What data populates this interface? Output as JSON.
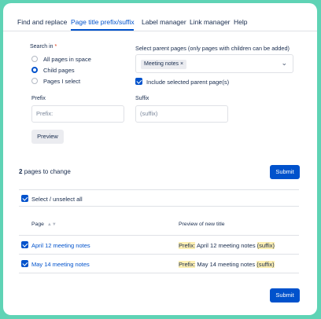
{
  "tabs": [
    "Find and replace",
    "Page title prefix/suffix",
    "Label manager",
    "Link manager",
    "Help"
  ],
  "search_in": {
    "label": "Search in",
    "required_mark": "*",
    "options": [
      "All pages in space",
      "Child pages",
      "Pages I select"
    ],
    "selected": "Child pages"
  },
  "parent_pages": {
    "label": "Select parent pages (only pages with children can be added)",
    "chip": "Meeting notes",
    "chip_remove": "×",
    "include_label": "Include selected parent page(s)",
    "include_checked": true
  },
  "prefix": {
    "label": "Prefix",
    "placeholder": "Prefix:"
  },
  "suffix": {
    "label": "Suffix",
    "placeholder": "(suffix)"
  },
  "preview_button": "Preview",
  "pages_count": "2",
  "pages_to_change_text": "pages to change",
  "submit_label": "Submit",
  "select_all_label": "Select / unselect all",
  "table": {
    "col_page": "Page",
    "col_preview": "Preview of new title",
    "rows": [
      {
        "page": "April 12 meeting notes",
        "prefix": "Prefix:",
        "title": "April 12 meeting notes",
        "suffix": "(suffix)"
      },
      {
        "page": "May 14 meeting notes",
        "prefix": "Prefix:",
        "title": "May 14 meeting notes",
        "suffix": "(suffix)"
      }
    ]
  },
  "colors": {
    "frame": "#5fd3b5",
    "accent": "#0052cc",
    "highlight": "#fff0b3"
  }
}
